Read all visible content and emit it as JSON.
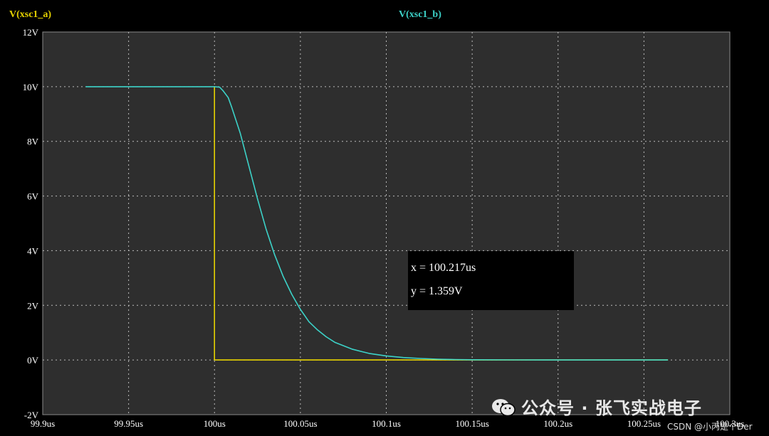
{
  "chart_data": {
    "type": "line",
    "title": "",
    "xlabel": "",
    "ylabel": "",
    "xlim": [
      99.9,
      100.3
    ],
    "ylim": [
      -2,
      12
    ],
    "x_ticks": [
      99.9,
      99.95,
      100,
      100.05,
      100.1,
      100.15,
      100.2,
      100.25,
      100.3
    ],
    "x_tick_labels": [
      "99.9us",
      "99.95us",
      "100us",
      "100.05us",
      "100.1us",
      "100.15us",
      "100.2us",
      "100.25us",
      "100.3us"
    ],
    "y_ticks": [
      -2,
      0,
      2,
      4,
      6,
      8,
      10,
      12
    ],
    "y_tick_labels": [
      "-2V",
      "0V",
      "2V",
      "4V",
      "6V",
      "8V",
      "10V",
      "12V"
    ],
    "grid": true,
    "series": [
      {
        "name": "V(xsc1_a)",
        "color": "#e6d200",
        "x": [
          100.0,
          100.0,
          100.001,
          100.264
        ],
        "y": [
          10,
          0,
          0,
          0
        ]
      },
      {
        "name": "V(xsc1_b)",
        "color": "#3cd2c8",
        "x": [
          99.925,
          100.0,
          100.003,
          100.005,
          100.008,
          100.01,
          100.015,
          100.02,
          100.025,
          100.03,
          100.035,
          100.04,
          100.045,
          100.05,
          100.055,
          100.06,
          100.065,
          100.07,
          100.08,
          100.09,
          100.1,
          100.11,
          100.12,
          100.13,
          100.14,
          100.15,
          100.175,
          100.2,
          100.225,
          100.264
        ],
        "y": [
          10,
          10,
          9.98,
          9.85,
          9.6,
          9.25,
          8.3,
          7.1,
          5.9,
          4.8,
          3.85,
          3.05,
          2.4,
          1.85,
          1.4,
          1.1,
          0.85,
          0.65,
          0.4,
          0.24,
          0.15,
          0.09,
          0.055,
          0.03,
          0.018,
          0.01,
          0.004,
          0.002,
          0.001,
          0
        ]
      }
    ],
    "legend_position": "top"
  },
  "cursor": {
    "x_text": "x = 100.217us",
    "y_text": "y = 1.359V"
  },
  "colors": {
    "background": "#000000",
    "plot_area": "#2e2e2e",
    "grid": "#bbbbbb",
    "axis_text": "#ffffff",
    "trace_a": "#e6d200",
    "trace_b": "#3cd2c8"
  },
  "watermark": {
    "text": "公众号 · 张飞实战电子",
    "icon": "wechat-icon"
  },
  "credit": "CSDN @小丙是个Der"
}
